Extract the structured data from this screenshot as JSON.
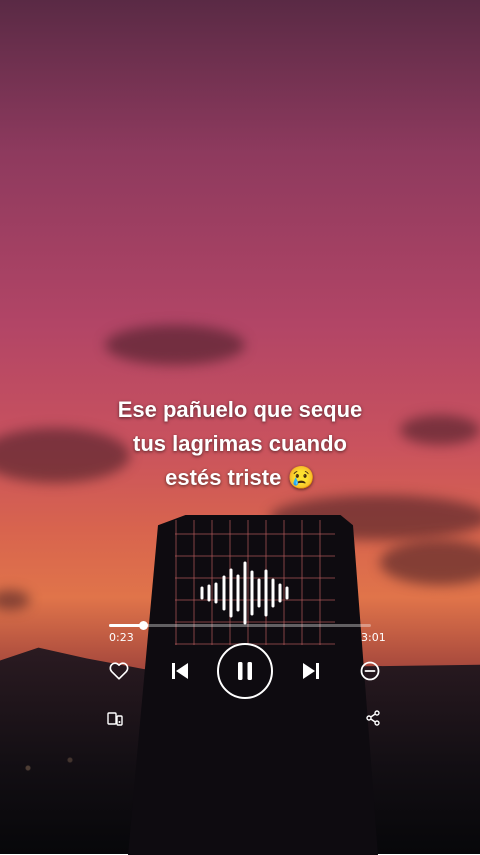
{
  "lyrics": {
    "line1": "Ese pañuelo que seque",
    "line2": "tus lagrimas cuando",
    "line3": "estés triste 😢"
  },
  "player": {
    "elapsed": "0:23",
    "duration": "3:01",
    "progress": 0.13,
    "state": "playing"
  },
  "icons": {
    "like": "heart-icon",
    "previous": "skip-previous-icon",
    "play_pause": "pause-icon",
    "next": "skip-next-icon",
    "remove": "minus-circle-icon",
    "device": "connect-device-icon",
    "share": "share-icon",
    "visualizer": "sound-wave-icon"
  },
  "colors": {
    "accent": "#ffffff",
    "sky_top": "#8e3a5e",
    "sky_bottom": "#e0744a"
  }
}
